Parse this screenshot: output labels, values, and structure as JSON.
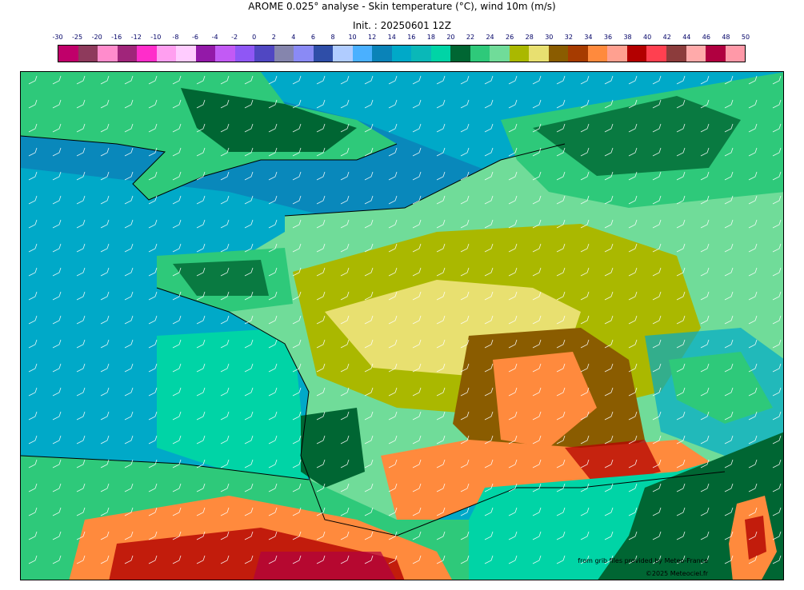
{
  "title": "AROME 0.025° analyse - Skin temperature (°C), wind 10m (m/s)",
  "init": "Init. : 20250601 12Z",
  "scale": {
    "labels": [
      "-30",
      "-25",
      "-20",
      "-16",
      "-12",
      "-10",
      "-8",
      "-6",
      "-4",
      "-2",
      "0",
      "2",
      "4",
      "6",
      "8",
      "10",
      "12",
      "14",
      "16",
      "18",
      "20",
      "22",
      "24",
      "26",
      "28",
      "30",
      "32",
      "34",
      "36",
      "38",
      "40",
      "42",
      "44",
      "46",
      "48",
      "50"
    ],
    "colors": [
      "#c0006a",
      "#8e3a5c",
      "#ff8ccc",
      "#a0257a",
      "#ff2dca",
      "#ff9ff0",
      "#ffccff",
      "#9319a8",
      "#c25af5",
      "#8f57f5",
      "#5047c2",
      "#8585ad",
      "#8a8af5",
      "#2f4ea8",
      "#b0ccff",
      "#4ab0ff",
      "#0a83b8",
      "#00a9c8",
      "#0ab8b8",
      "#00d4a6",
      "#006633",
      "#2ec97a",
      "#70dc99",
      "#aab800",
      "#e8e070",
      "#8a5c00",
      "#a63b00",
      "#ff8a3d",
      "#ffa090",
      "#b30000",
      "#ff4050",
      "#8c3c3c",
      "#ffaaaa",
      "#b00040",
      "#ff99a8"
    ]
  },
  "map": {
    "sea_color": "#00a9c8",
    "sea_north_color": "#0a83b8",
    "med_color": "#00d4a6",
    "land_base_color": "#70dc99",
    "warm_color": "#aab800",
    "hot_color": "#ff8a3d",
    "cool_land_color": "#006633",
    "wind_barb_color": "#ffffff"
  },
  "credits": {
    "source": "from grib files provided by Meteo-France",
    "copyright": "©2025 Meteociel.fr"
  }
}
